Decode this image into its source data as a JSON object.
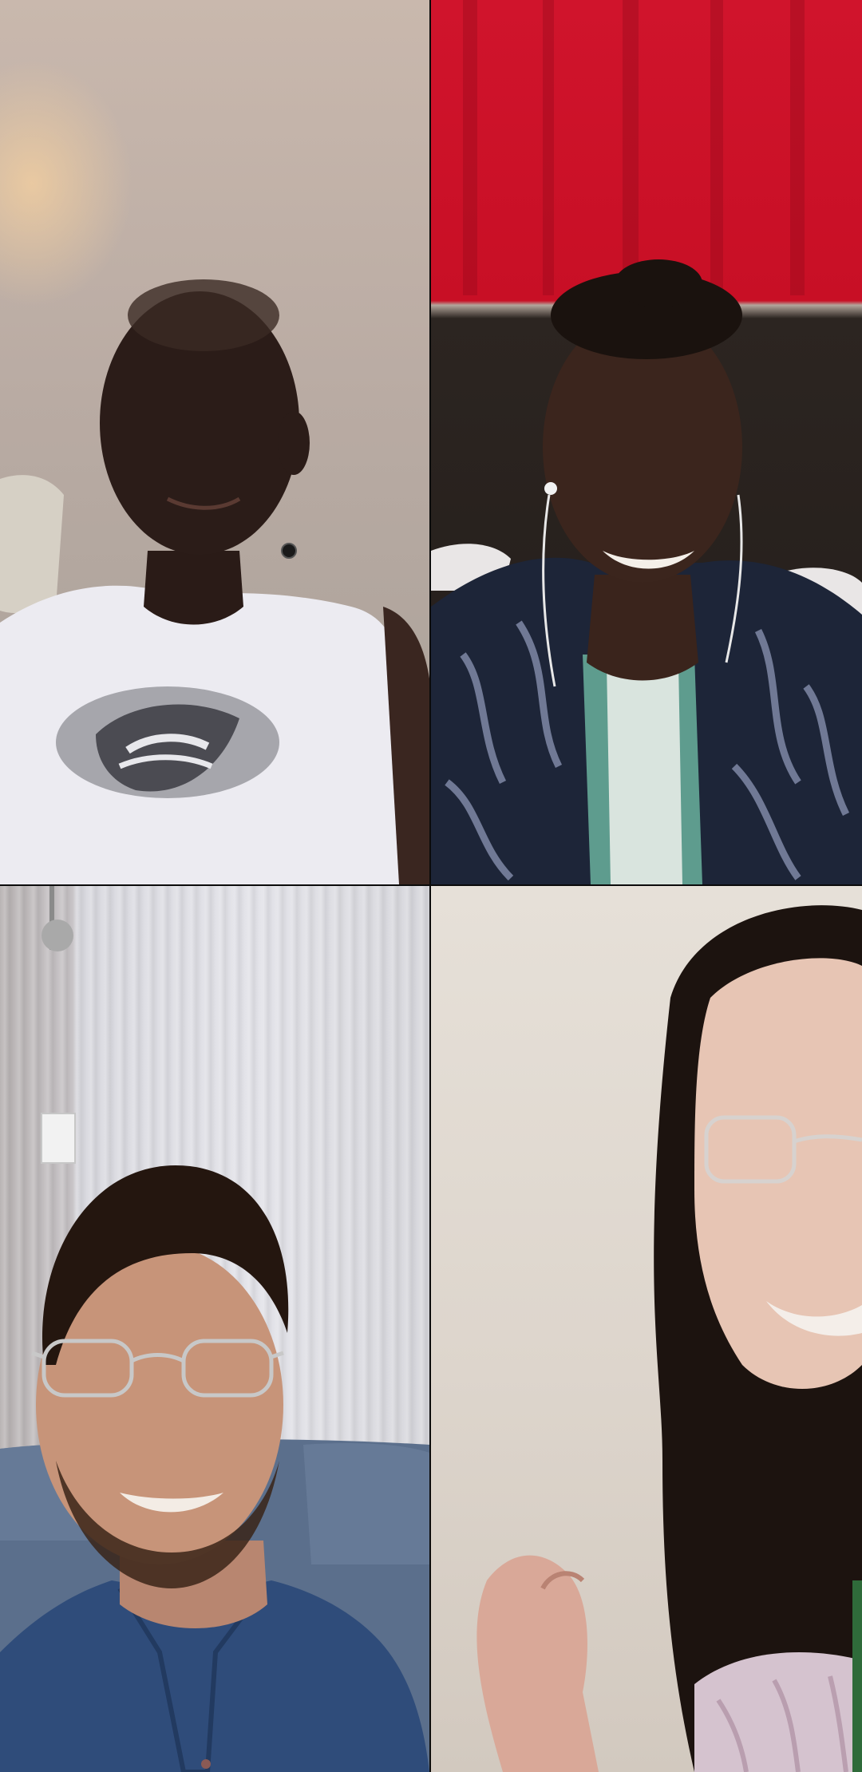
{
  "call": {
    "layout": "2x2 video grid",
    "participants": [
      {
        "tile": "top-left",
        "video": "participant-1-video",
        "video_on": true
      },
      {
        "tile": "top-right",
        "video": "participant-2-video",
        "video_on": true
      },
      {
        "tile": "bottom-left",
        "video": "participant-3-video",
        "video_on": true
      },
      {
        "tile": "bottom-right",
        "video": "participant-4-video",
        "video_on": true
      }
    ]
  }
}
